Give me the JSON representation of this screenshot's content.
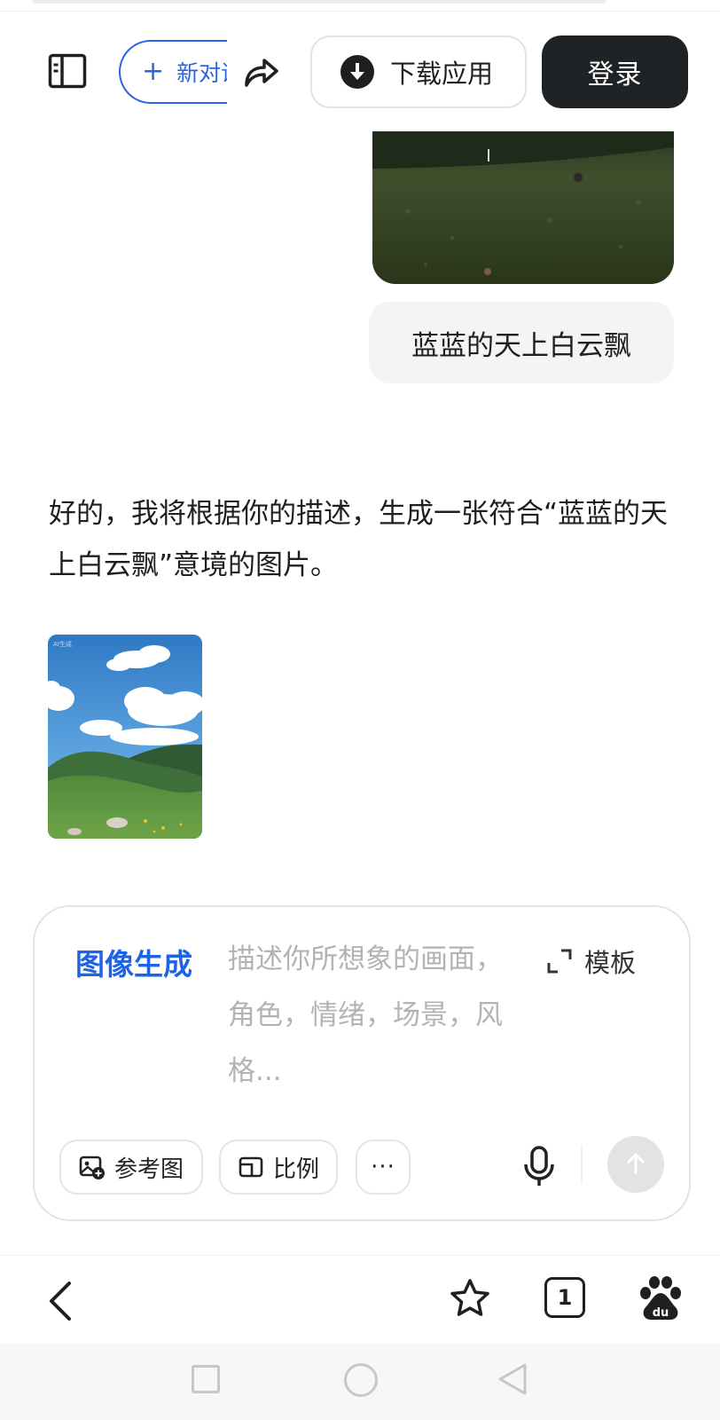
{
  "header": {
    "new_chat_label": "新对话",
    "download_label": "下载应用",
    "login_label": "登录"
  },
  "chat": {
    "user_message": "蓝蓝的天上白云飘",
    "assistant_message": "好的，我将根据你的描述，生成一张符合“蓝蓝的天上白云飘”意境的图片。",
    "generated_image_watermark": "AI生成"
  },
  "composer": {
    "mode_label": "图像生成",
    "placeholder": "描述你所想象的画面，角色，情绪，场景，风格...",
    "template_label": "模板",
    "tools": {
      "reference_label": "参考图",
      "ratio_label": "比例",
      "more_label": "···"
    }
  },
  "browser": {
    "tab_count": "1"
  },
  "icons": {
    "sidebar": "sidebar-icon",
    "share": "share-icon",
    "download": "download-icon",
    "expand": "expand-icon",
    "reference": "image-add-icon",
    "ratio": "ratio-icon",
    "mic": "microphone-icon",
    "send": "arrow-up-icon",
    "back": "chevron-left-icon",
    "star": "star-icon",
    "baidu": "baidu-paw-icon"
  },
  "colors": {
    "accent": "#1e63e6",
    "login_bg": "#202326",
    "send_disabled": "#e3e3e3"
  }
}
